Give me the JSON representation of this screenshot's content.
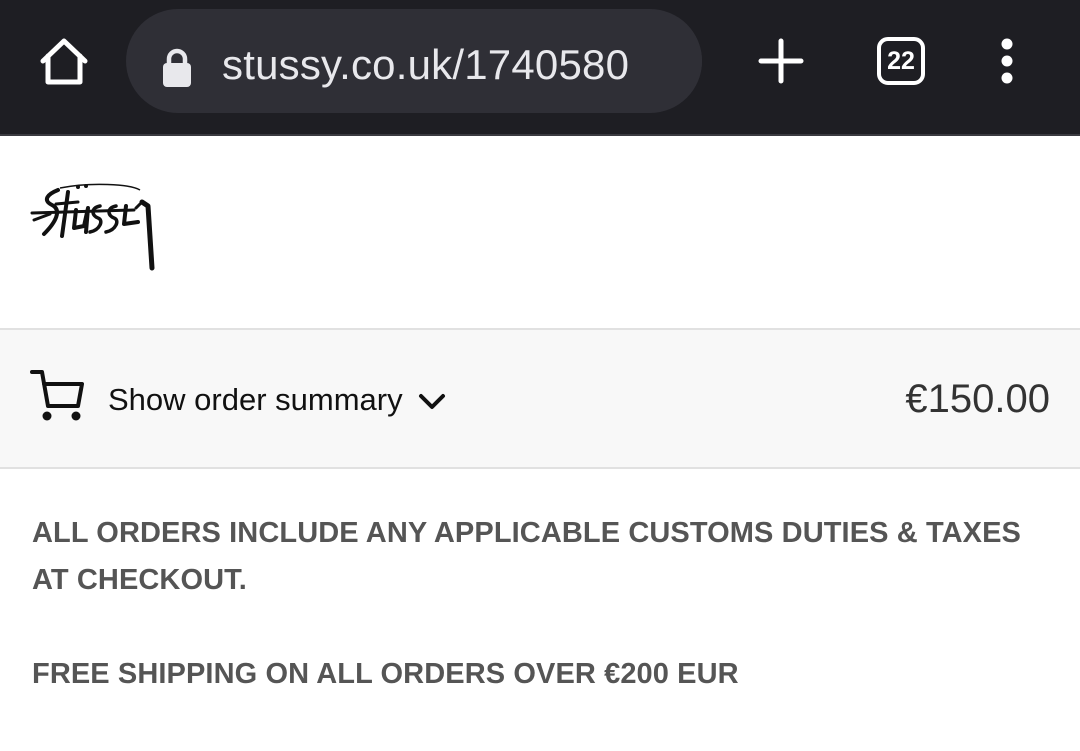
{
  "browser": {
    "url": "stussy.co.uk/1740580",
    "tab_count": "22",
    "icons": {
      "home": "home-icon",
      "lock": "lock-icon",
      "new_tab": "plus-icon",
      "menu": "more-vert-icon"
    },
    "colors": {
      "toolbar": "#1e1e23",
      "urlbar": "#2f2f36"
    }
  },
  "brand": {
    "logo": "Stüssy"
  },
  "order_summary": {
    "label": "Show order summary",
    "total": "€150.00",
    "icons": {
      "cart": "cart-icon",
      "chevron": "chevron-down-icon"
    }
  },
  "notices": [
    "ALL ORDERS INCLUDE ANY APPLICABLE CUSTOMS DUTIES & TAXES AT CHECKOUT.",
    "FREE SHIPPING ON ALL ORDERS OVER €200 EUR"
  ]
}
